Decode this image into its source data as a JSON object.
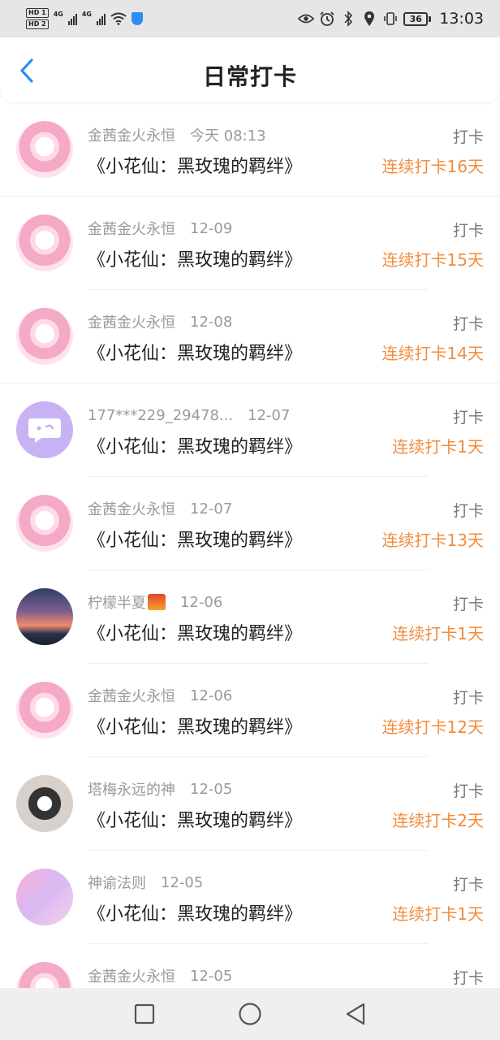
{
  "status_bar": {
    "hd1": "HD 1",
    "hd2": "HD 2",
    "net1": "4G",
    "net2": "4G",
    "battery": "36",
    "time": "13:03"
  },
  "header": {
    "title": "日常打卡"
  },
  "items": [
    {
      "name": "金茜金火永恒",
      "time": "今天 08:13",
      "title": "《小花仙：黑玫瑰的羁绊》",
      "action": "打卡",
      "streak": "连续打卡16天",
      "avatar": "anime"
    },
    {
      "name": "金茜金火永恒",
      "time": "12-09",
      "title": "《小花仙：黑玫瑰的羁绊》",
      "action": "打卡",
      "streak": "连续打卡15天",
      "avatar": "anime"
    },
    {
      "name": "金茜金火永恒",
      "time": "12-08",
      "title": "《小花仙：黑玫瑰的羁绊》",
      "action": "打卡",
      "streak": "连续打卡14天",
      "avatar": "anime"
    },
    {
      "name": "177***229_29478...",
      "time": "12-07",
      "title": "《小花仙：黑玫瑰的羁绊》",
      "action": "打卡",
      "streak": "连续打卡1天",
      "avatar": "chat"
    },
    {
      "name": "金茜金火永恒",
      "time": "12-07",
      "title": "《小花仙：黑玫瑰的羁绊》",
      "action": "打卡",
      "streak": "连续打卡13天",
      "avatar": "anime"
    },
    {
      "name": "柠檬半夏",
      "time": "12-06",
      "title": "《小花仙：黑玫瑰的羁绊》",
      "action": "打卡",
      "streak": "连续打卡1天",
      "avatar": "sunset"
    },
    {
      "name": "金茜金火永恒",
      "time": "12-06",
      "title": "《小花仙：黑玫瑰的羁绊》",
      "action": "打卡",
      "streak": "连续打卡12天",
      "avatar": "anime"
    },
    {
      "name": "塔梅永远的神",
      "time": "12-05",
      "title": "《小花仙：黑玫瑰的羁绊》",
      "action": "打卡",
      "streak": "连续打卡2天",
      "avatar": "dark"
    },
    {
      "name": "神谕法则",
      "time": "12-05",
      "title": "《小花仙：黑玫瑰的羁绊》",
      "action": "打卡",
      "streak": "连续打卡1天",
      "avatar": "pastel"
    },
    {
      "name": "金茜金火永恒",
      "time": "12-05",
      "title": "",
      "action": "打卡",
      "streak": "",
      "avatar": "anime"
    }
  ],
  "colors": {
    "accent_blue": "#2f8ef3",
    "streak_orange": "#f28c3c",
    "status_bar_bg": "#e6e6e6"
  },
  "icons": {
    "back": "chevron-left-icon",
    "nav": [
      "square-recent-apps-icon",
      "circle-home-icon",
      "triangle-back-icon"
    ]
  }
}
